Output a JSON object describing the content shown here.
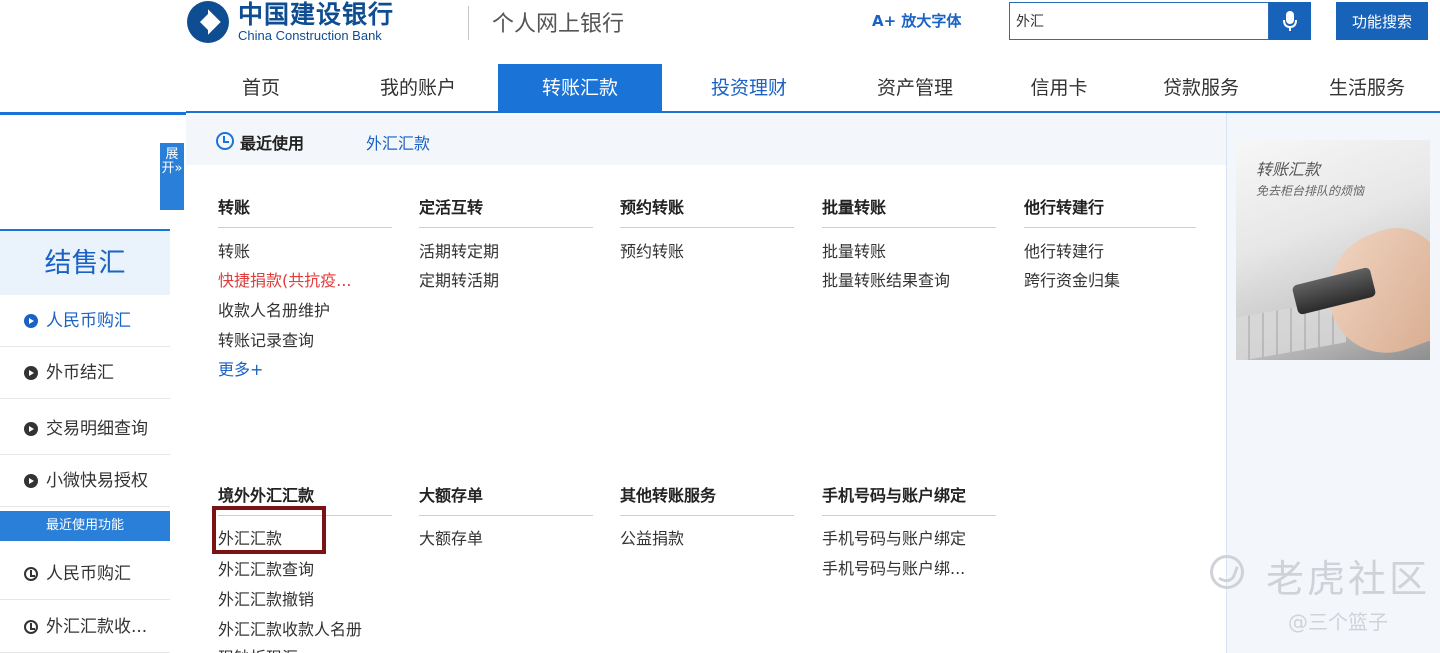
{
  "header": {
    "logo_cn": "中国建设银行",
    "logo_en": "China Construction Bank",
    "site_title": "个人网上银行",
    "enlarge_font": "A+ 放大字体",
    "search_value": "外汇",
    "search_button": "功能搜索"
  },
  "nav": [
    {
      "label": "首页"
    },
    {
      "label": "我的账户"
    },
    {
      "label": "转账汇款"
    },
    {
      "label": "投资理财"
    },
    {
      "label": "资产管理"
    },
    {
      "label": "信用卡"
    },
    {
      "label": "贷款服务"
    },
    {
      "label": "生活服务"
    }
  ],
  "sidebar": {
    "expand_label": "展开»",
    "title": "结售汇",
    "items": [
      {
        "label": "人民币购汇"
      },
      {
        "label": "外币结汇"
      },
      {
        "label": "交易明细查询"
      },
      {
        "label": "小微快易授权"
      }
    ],
    "recent_header": "最近使用功能",
    "recent_items": [
      {
        "label": "人民币购汇"
      },
      {
        "label": "外汇汇款收..."
      }
    ]
  },
  "recent": {
    "label": "最近使用",
    "link": "外汇汇款"
  },
  "menu": {
    "row1": [
      {
        "head": "转账",
        "links": [
          "转账",
          "快捷捐款(共抗疫...",
          "收款人名册维护",
          "转账记录查询",
          "更多+"
        ]
      },
      {
        "head": "定活互转",
        "links": [
          "活期转定期",
          "定期转活期"
        ]
      },
      {
        "head": "预约转账",
        "links": [
          "预约转账"
        ]
      },
      {
        "head": "批量转账",
        "links": [
          "批量转账",
          "批量转账结果查询"
        ]
      },
      {
        "head": "他行转建行",
        "links": [
          "他行转建行",
          "跨行资金归集"
        ]
      }
    ],
    "row2": [
      {
        "head": "境外外汇汇款",
        "links": [
          "外汇汇款",
          "外汇汇款查询",
          "外汇汇款撤销",
          "外汇汇款收款人名册",
          "现钞折现汇"
        ]
      },
      {
        "head": "大额存单",
        "links": [
          "大额存单"
        ]
      },
      {
        "head": "其他转账服务",
        "links": [
          "公益捐款"
        ]
      },
      {
        "head": "手机号码与账户绑定",
        "links": [
          "手机号码与账户绑定",
          "手机号码与账户绑..."
        ]
      }
    ]
  },
  "promo": {
    "title": "转账汇款",
    "subtitle": "免去柜台排队的烦恼"
  },
  "watermark": {
    "text": "老虎社区",
    "user": "@三个篮子"
  },
  "colors": {
    "brand_blue": "#1a73d6",
    "link_blue": "#1a62c4",
    "alert_red": "#e03d3d",
    "highlight": "#7a1414"
  }
}
